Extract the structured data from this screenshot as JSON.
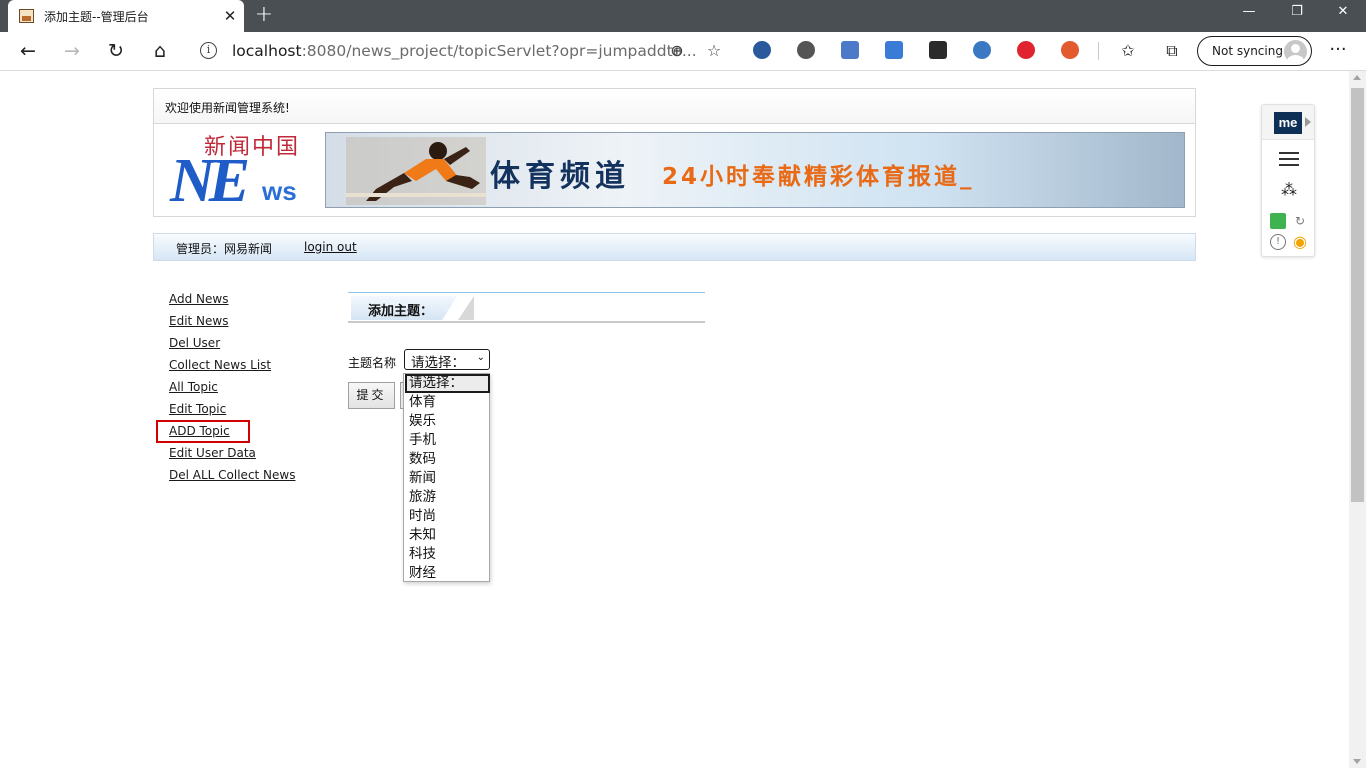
{
  "browser": {
    "tab": {
      "title": "添加主题--管理后台",
      "close_glyph": "✕"
    },
    "new_tab_glyph": "+",
    "window_controls": {
      "minimize": "—",
      "restore": "❐",
      "close": "✕"
    },
    "nav": {
      "back": "←",
      "forward": "→",
      "refresh": "↻",
      "home": "⌂"
    },
    "address": {
      "info_glyph": "i",
      "host": "localhost",
      "path": ":8080/news_project/topicServlet?opr=jumpaddto...",
      "zoom_glyph": "⊕",
      "favorite_glyph": "☆"
    },
    "toolbar": {
      "favorites_glyph": "✩",
      "collections_glyph": "⧉",
      "more_glyph": "···"
    },
    "sync": {
      "label": "Not syncing"
    },
    "extension_colors": [
      "#2a5a9c",
      "#555555",
      "#4c7ac9",
      "#3a7bd5",
      "#2b2b2b",
      "#3b78c4",
      "#e0242f",
      "#e25a2d"
    ]
  },
  "page": {
    "welcome": "欢迎使用新闻管理系统!",
    "logo": {
      "cn_text": "新闻中国",
      "big_letters": "NE",
      "small_letters": "ws"
    },
    "banner": {
      "title": "体育频道",
      "slogan": "24小时奉献精彩体育报道_"
    },
    "admin": {
      "label": "管理员：网易新闻",
      "logout": "login out"
    },
    "sidebar": [
      {
        "label": "Add News"
      },
      {
        "label": "Edit News"
      },
      {
        "label": "Del User"
      },
      {
        "label": "Collect News List"
      },
      {
        "label": "All Topic"
      },
      {
        "label": "Edit Topic"
      },
      {
        "label": "ADD Topic",
        "highlighted": true
      },
      {
        "label": "Edit User Data"
      },
      {
        "label": "Del ALL Collect News"
      }
    ],
    "form": {
      "section_title": "添加主题：",
      "field_label": "主题名称",
      "select_value": "请选择：",
      "select_chevron": "⌄",
      "submit_label": "提交",
      "options": [
        "请选择：",
        "体育",
        "娱乐",
        "手机",
        "数码",
        "新闻",
        "旅游",
        "时尚",
        "未知",
        "科技",
        "财经"
      ]
    }
  },
  "extension_panel": {
    "logo_text": "me",
    "wand_glyph": "⁂",
    "refresh_glyph": "↻",
    "alert_glyph": "!",
    "eye_glyph": "◉"
  },
  "colors": {
    "highlight_border": "#d20000",
    "tab_strip": "#4a4f54",
    "logo_blue": "#1f5cc8",
    "logo_red": "#c0293a",
    "slogan_orange": "#e86a16"
  }
}
